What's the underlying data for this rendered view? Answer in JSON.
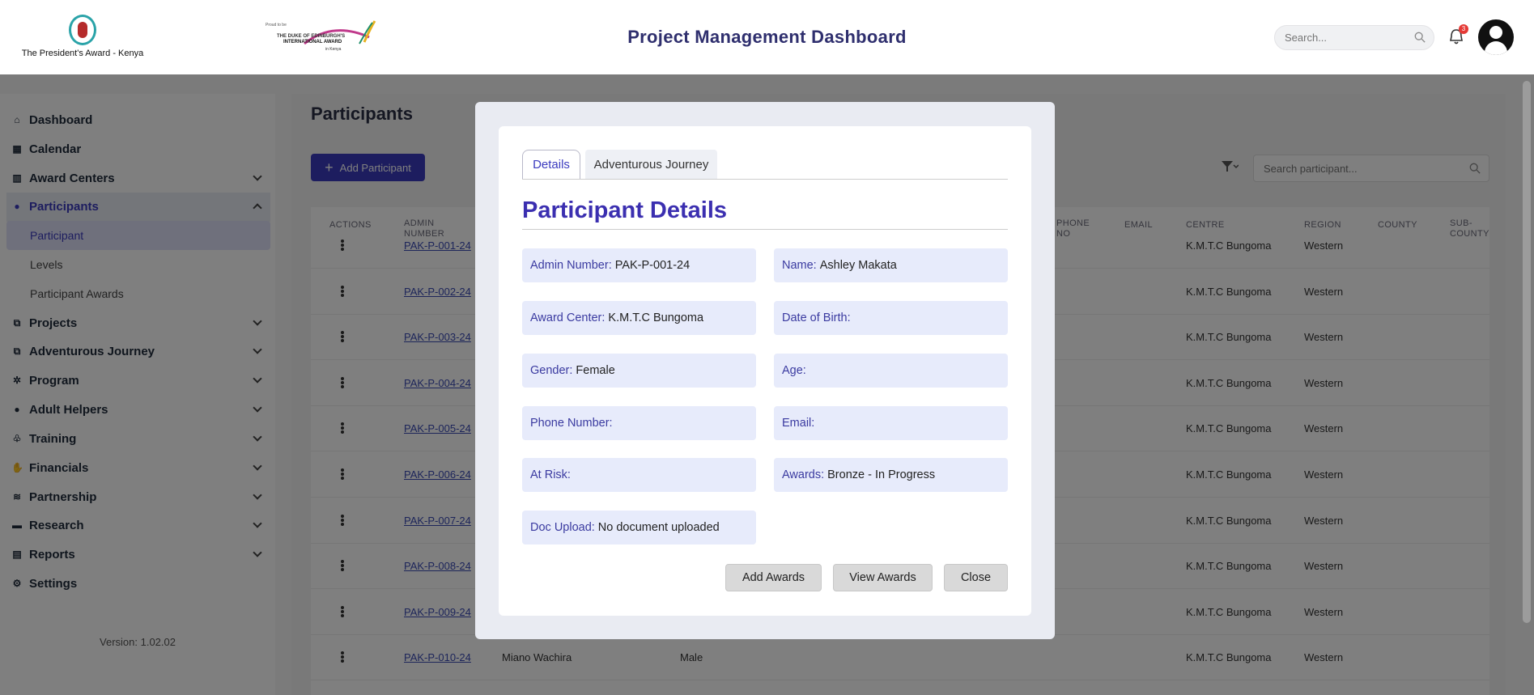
{
  "header": {
    "org_name": "The President's Award - Kenya",
    "partner_logo": {
      "line1": "Proud to be",
      "line2": "THE DUKE OF EDINBURGH'S",
      "line3": "INTERNATIONAL AWARD",
      "line4": "in Kenya"
    },
    "title": "Project Management Dashboard",
    "search_placeholder": "Search...",
    "notification_count": "3"
  },
  "sidebar": {
    "items": [
      {
        "label": "Dashboard",
        "icon": "home-icon"
      },
      {
        "label": "Calendar",
        "icon": "calendar-icon"
      },
      {
        "label": "Award Centers",
        "icon": "building-icon"
      },
      {
        "label": "Participants",
        "icon": "user-icon"
      },
      {
        "label": "Projects",
        "icon": "diagram-icon"
      },
      {
        "label": "Adventurous Journey",
        "icon": "diagram-icon"
      },
      {
        "label": "Program",
        "icon": "cogs-icon"
      },
      {
        "label": "Adult Helpers",
        "icon": "user-icon"
      },
      {
        "label": "Training",
        "icon": "seedling-icon"
      },
      {
        "label": "Financials",
        "icon": "hand-money-icon"
      },
      {
        "label": "Partnership",
        "icon": "layers-icon"
      },
      {
        "label": "Research",
        "icon": "book-icon"
      },
      {
        "label": "Reports",
        "icon": "file-chart-icon"
      },
      {
        "label": "Settings",
        "icon": "gear-icon"
      }
    ],
    "sub_items": [
      "Participant",
      "Levels",
      "Participant Awards"
    ],
    "version": "Version: 1.02.02"
  },
  "page": {
    "title": "Participants",
    "add_button": "Add Participant",
    "search_placeholder": "Search participant..."
  },
  "table": {
    "headers": {
      "actions": "ACTIONS",
      "admin_number": "ADMIN NUMBER",
      "phone_no": "PHONE NO",
      "email": "EMAIL",
      "centre": "CENTRE",
      "region": "REGION",
      "county": "COUNTY",
      "sub_county": "SUB-COUNTY"
    },
    "rows": [
      {
        "admin": "PAK-P-001-24",
        "name": "",
        "gender": "",
        "centre": "K.M.T.C Bungoma",
        "region": "Western"
      },
      {
        "admin": "PAK-P-002-24",
        "name": "",
        "gender": "",
        "centre": "K.M.T.C Bungoma",
        "region": "Western"
      },
      {
        "admin": "PAK-P-003-24",
        "name": "",
        "gender": "",
        "centre": "K.M.T.C Bungoma",
        "region": "Western"
      },
      {
        "admin": "PAK-P-004-24",
        "name": "",
        "gender": "",
        "centre": "K.M.T.C Bungoma",
        "region": "Western"
      },
      {
        "admin": "PAK-P-005-24",
        "name": "",
        "gender": "",
        "centre": "K.M.T.C Bungoma",
        "region": "Western"
      },
      {
        "admin": "PAK-P-006-24",
        "name": "",
        "gender": "",
        "centre": "K.M.T.C Bungoma",
        "region": "Western"
      },
      {
        "admin": "PAK-P-007-24",
        "name": "",
        "gender": "",
        "centre": "K.M.T.C Bungoma",
        "region": "Western"
      },
      {
        "admin": "PAK-P-008-24",
        "name": "",
        "gender": "",
        "centre": "K.M.T.C Bungoma",
        "region": "Western"
      },
      {
        "admin": "PAK-P-009-24",
        "name": "",
        "gender": "",
        "centre": "K.M.T.C Bungoma",
        "region": "Western"
      },
      {
        "admin": "PAK-P-010-24",
        "name": "Miano Wachira",
        "gender": "Male",
        "centre": "K.M.T.C Bungoma",
        "region": "Western"
      }
    ]
  },
  "modal": {
    "tabs": [
      "Details",
      "Adventurous Journey"
    ],
    "title": "Participant Details",
    "fields": {
      "admin_number": {
        "label": "Admin Number:",
        "value": "PAK-P-001-24"
      },
      "name": {
        "label": "Name:",
        "value": "Ashley Makata"
      },
      "award_center": {
        "label": "Award Center:",
        "value": "K.M.T.C Bungoma"
      },
      "dob": {
        "label": "Date of Birth:",
        "value": ""
      },
      "gender": {
        "label": "Gender:",
        "value": "Female"
      },
      "age": {
        "label": "Age:",
        "value": ""
      },
      "phone": {
        "label": "Phone Number:",
        "value": ""
      },
      "email": {
        "label": "Email:",
        "value": ""
      },
      "at_risk": {
        "label": "At Risk:",
        "value": ""
      },
      "awards": {
        "label": "Awards:",
        "value": "Bronze - In Progress"
      },
      "doc_upload": {
        "label": "Doc Upload:",
        "value": "No document uploaded"
      }
    },
    "buttons": {
      "add_awards": "Add Awards",
      "view_awards": "View Awards",
      "close": "Close"
    }
  },
  "colors": {
    "accent": "#3b3bbf",
    "title_purple": "#3b2fb0",
    "field_bg": "#e7ebfb"
  }
}
